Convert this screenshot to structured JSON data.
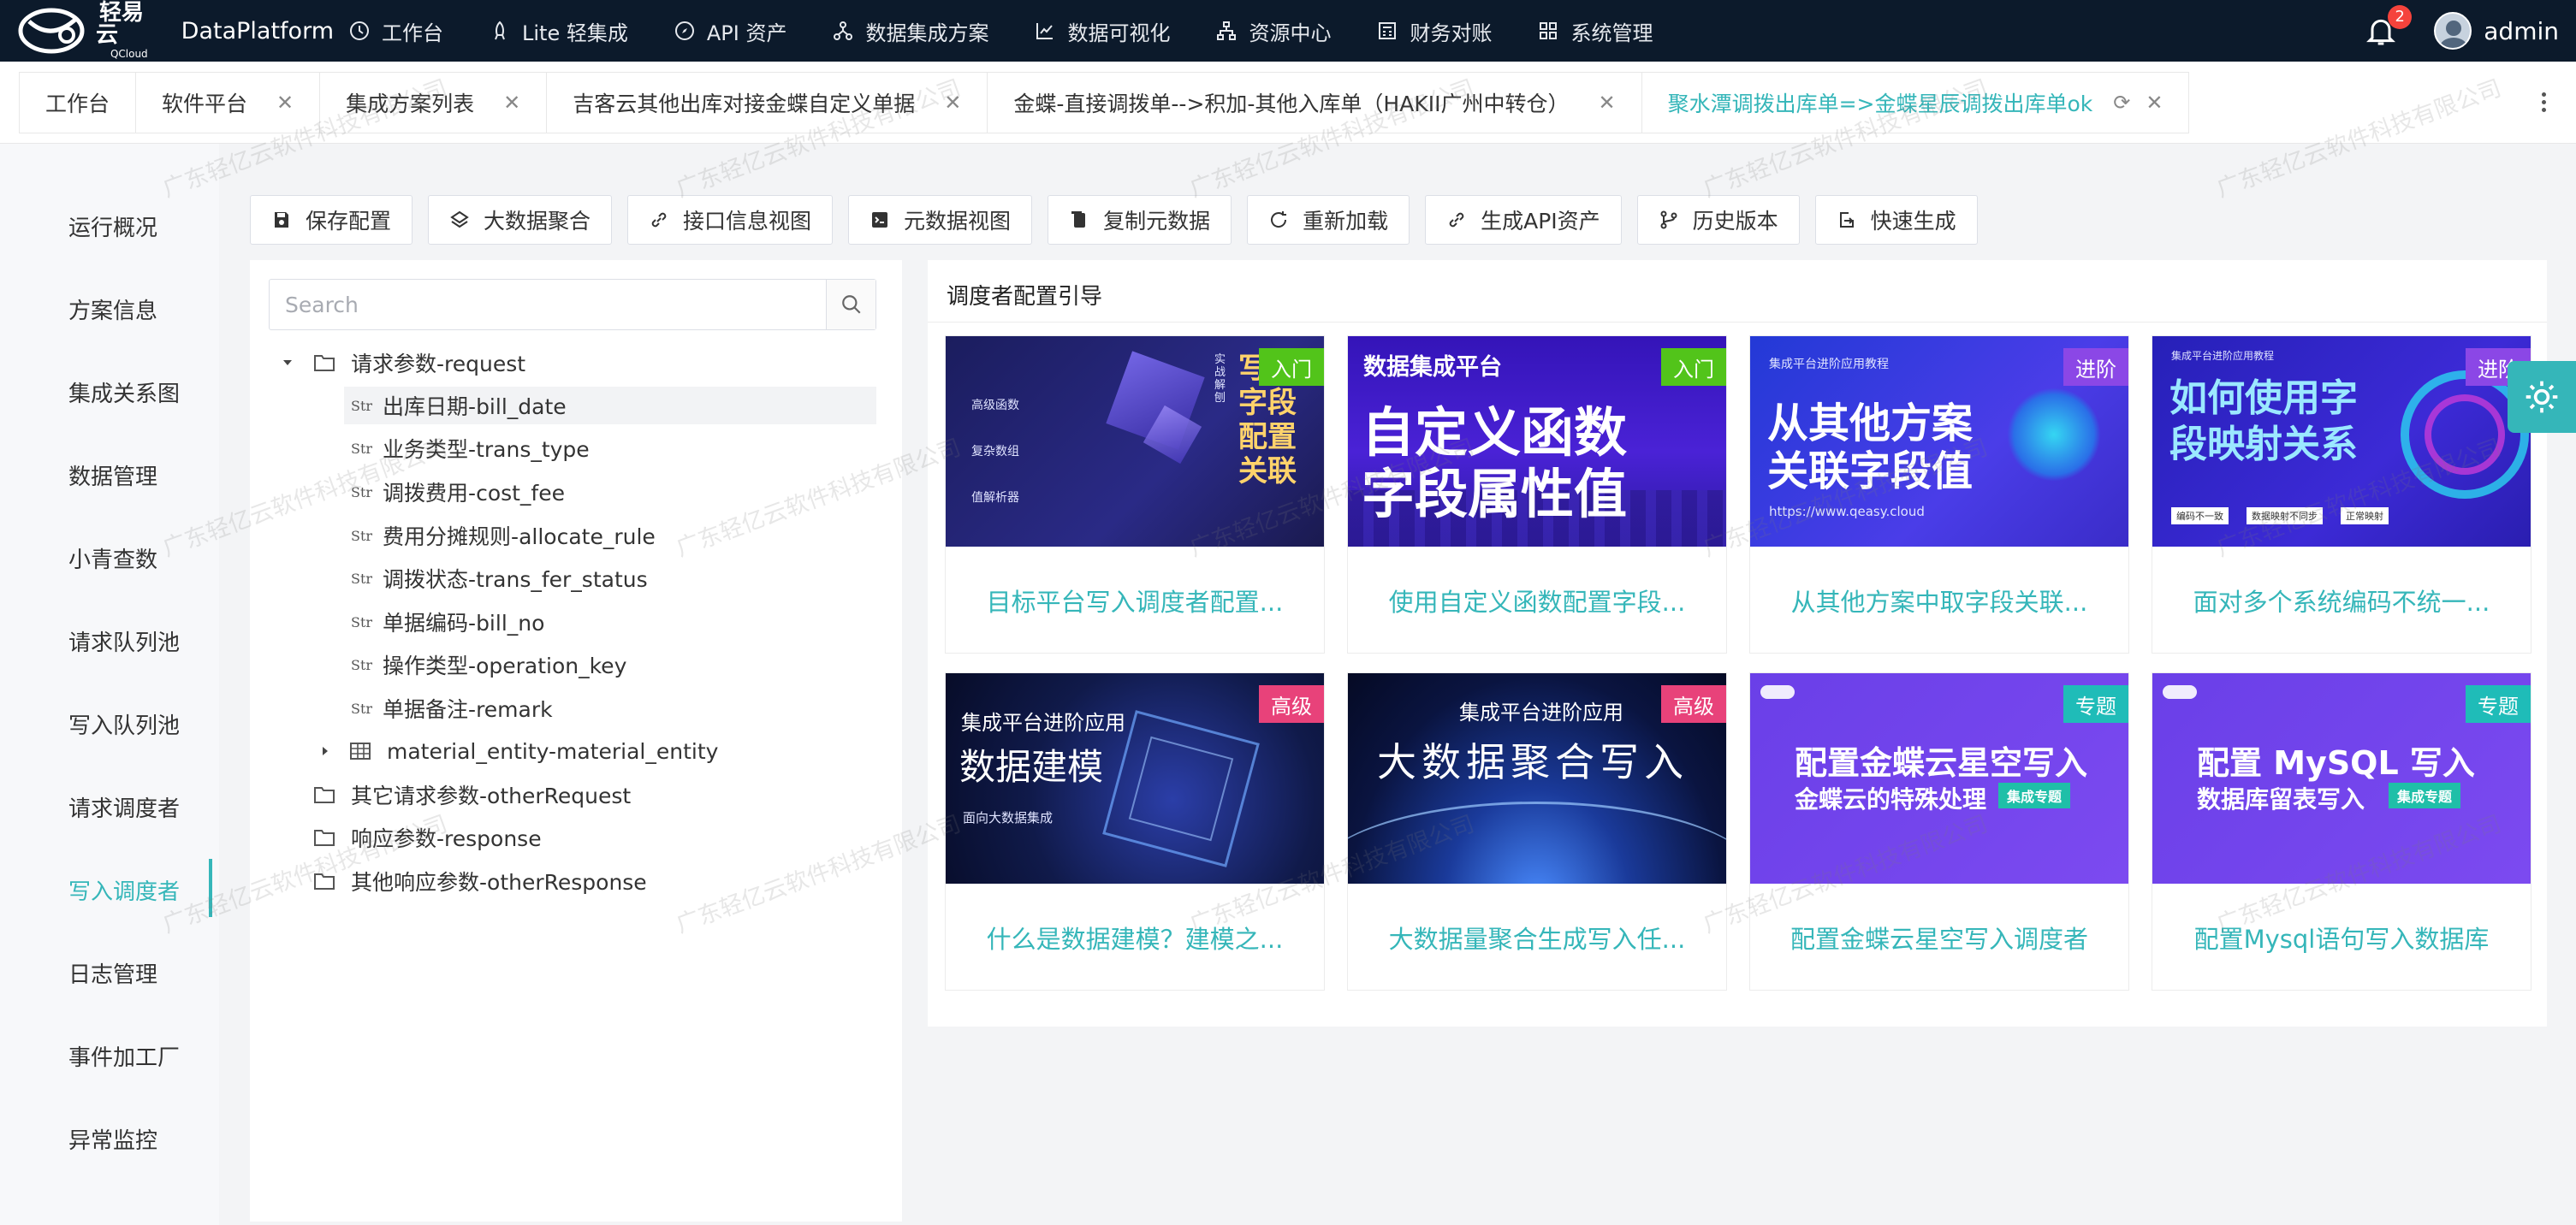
{
  "topnav": {
    "logo_text": "轻易云",
    "logo_sub": "QCloud",
    "platform": "DataPlatform",
    "items": [
      {
        "label": "工作台",
        "icon": "clock-icon"
      },
      {
        "label": "Lite 轻集成",
        "icon": "rocket-icon"
      },
      {
        "label": "API 资产",
        "icon": "compass-icon"
      },
      {
        "label": "数据集成方案",
        "icon": "network-icon"
      },
      {
        "label": "数据可视化",
        "icon": "chart-icon"
      },
      {
        "label": "资源中心",
        "icon": "hierarchy-icon"
      },
      {
        "label": "财务对账",
        "icon": "calculator-icon"
      },
      {
        "label": "系统管理",
        "icon": "grid-icon"
      }
    ],
    "notifications": "2",
    "username": "admin"
  },
  "tabs": [
    {
      "label": "工作台",
      "closable": false
    },
    {
      "label": "软件平台",
      "closable": true
    },
    {
      "label": "集成方案列表",
      "closable": true
    },
    {
      "label": "吉客云其他出库对接金蝶自定义单据",
      "closable": true
    },
    {
      "label": "金蝶-直接调拨单-->积加-其他入库单（HAKII广州中转仓）",
      "closable": true
    },
    {
      "label": "聚水潭调拨出库单=>金蝶星辰调拨出库单ok",
      "closable": true,
      "active": true
    }
  ],
  "sidebar": {
    "items": [
      "运行概况",
      "方案信息",
      "集成关系图",
      "数据管理",
      "小青查数",
      "请求队列池",
      "写入队列池",
      "请求调度者",
      "写入调度者",
      "日志管理",
      "事件加工厂",
      "异常监控"
    ],
    "active_index": 8
  },
  "toolbar": {
    "buttons": [
      {
        "label": "保存配置",
        "icon": "save-icon"
      },
      {
        "label": "大数据聚合",
        "icon": "aggregate-icon"
      },
      {
        "label": "接口信息视图",
        "icon": "link-icon"
      },
      {
        "label": "元数据视图",
        "icon": "terminal-icon"
      },
      {
        "label": "复制元数据",
        "icon": "copy-icon"
      },
      {
        "label": "重新加载",
        "icon": "reload-icon"
      },
      {
        "label": "生成API资产",
        "icon": "api-icon"
      },
      {
        "label": "历史版本",
        "icon": "branch-icon"
      },
      {
        "label": "快速生成",
        "icon": "export-icon"
      }
    ]
  },
  "tree": {
    "search_placeholder": "Search",
    "str_tag": "Str",
    "nodes": [
      {
        "label": "请求参数-request",
        "type": "folder",
        "expanded": true,
        "level": 0
      },
      {
        "label": "出库日期-bill_date",
        "type": "str",
        "level": 1,
        "selected": true
      },
      {
        "label": "业务类型-trans_type",
        "type": "str",
        "level": 1
      },
      {
        "label": "调拨费用-cost_fee",
        "type": "str",
        "level": 1
      },
      {
        "label": "费用分摊规则-allocate_rule",
        "type": "str",
        "level": 1
      },
      {
        "label": "调拨状态-trans_fer_status",
        "type": "str",
        "level": 1
      },
      {
        "label": "单据编码-bill_no",
        "type": "str",
        "level": 1
      },
      {
        "label": "操作类型-operation_key",
        "type": "str",
        "level": 1
      },
      {
        "label": "单据备注-remark",
        "type": "str",
        "level": 1
      },
      {
        "label": "material_entity-material_entity",
        "type": "table",
        "level": 1
      },
      {
        "label": "其它请求参数-otherRequest",
        "type": "folder",
        "level": 0
      },
      {
        "label": "响应参数-response",
        "type": "folder",
        "level": 0
      },
      {
        "label": "其他响应参数-otherResponse",
        "type": "folder",
        "level": 0
      }
    ]
  },
  "guide": {
    "title": "调度者配置引导",
    "cards": [
      {
        "title": "目标平台写入调度者配置...",
        "tag": "入门",
        "tag_color": "green",
        "img_main": "写入字段配置关联",
        "img_lines": [
          "实战解刨",
          "高级函数",
          "复杂数组",
          "值解析器"
        ]
      },
      {
        "title": "使用自定义函数配置字段...",
        "tag": "入门",
        "tag_color": "green",
        "img_main": "自定义函数",
        "img_main2": "字段属性值",
        "img_top": "数据集成平台"
      },
      {
        "title": "从其他方案中取字段关联...",
        "tag": "进阶",
        "tag_color": "purple",
        "img_main": "从其他方案",
        "img_main2": "关联字段值",
        "img_top": "集成平台进阶应用教程",
        "img_url": "https://www.qeasy.cloud"
      },
      {
        "title": "面对多个系统编码不统一...",
        "tag": "进阶",
        "tag_color": "purple",
        "img_main": "如何使用字",
        "img_main2": "段映射关系",
        "img_top": "集成平台进阶应用教程",
        "img_chips": [
          "编码不一致",
          "数据映射不同步",
          "正常映射"
        ]
      },
      {
        "title": "什么是数据建模？建模之...",
        "tag": "高级",
        "tag_color": "pink",
        "img_top": "集成平台进阶应用",
        "img_main": "数据建模",
        "img_sub": "面向大数据集成"
      },
      {
        "title": "大数据量聚合生成写入任...",
        "tag": "高级",
        "tag_color": "pink",
        "img_top": "集成平台进阶应用",
        "img_main": "大数据聚合写入"
      },
      {
        "title": "配置金蝶云星空写入调度者",
        "tag": "专题",
        "tag_color": "teal",
        "img_main": "配置金蝶云星空写入",
        "img_main2": "金蝶云的特殊处理",
        "img_chip": "集成专题"
      },
      {
        "title": "配置Mysql语句写入数据库",
        "tag": "专题",
        "tag_color": "teal",
        "img_main": "配置 MySQL 写入",
        "img_main2": "数据库留表写入",
        "img_chip": "集成专题"
      }
    ]
  },
  "watermark": "广东轻亿云软件科技有限公司",
  "colors": {
    "accent": "#35b6b9",
    "nav_bg": "#0c1a2b",
    "badge": "#f5433c"
  }
}
